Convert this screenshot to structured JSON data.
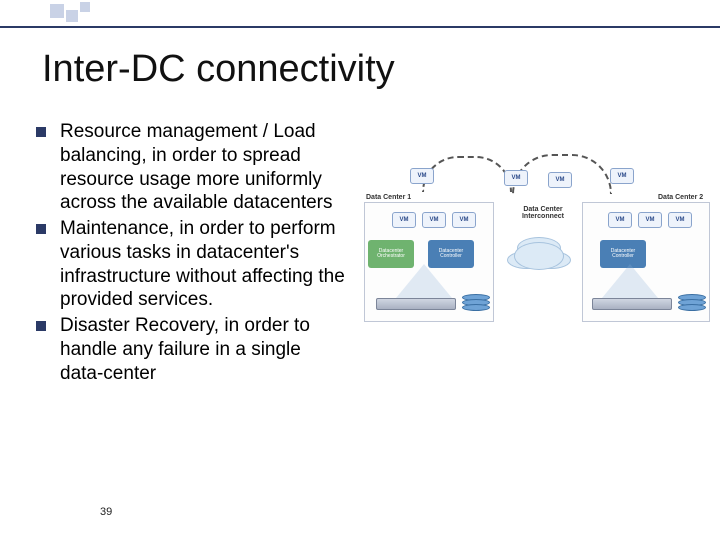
{
  "title": "Inter-DC connectivity",
  "bullets": [
    "Resource management / Load balancing, in order to spread resource usage more uniformly across the available datacenters",
    "Maintenance, in order to perform various tasks in datacenter's infrastructure without affecting the provided services.",
    "Disaster Recovery, in order to handle any failure in a single data-center"
  ],
  "page_number": "39",
  "diagram": {
    "vm_label": "VM",
    "dc1_label": "Data Center 1",
    "dc2_label": "Data Center 2",
    "interconnect_label": "Data Center Interconnect",
    "orchestrator_label": "Datacenter Orchestrator",
    "controller_label": "Datacenter Controller"
  }
}
